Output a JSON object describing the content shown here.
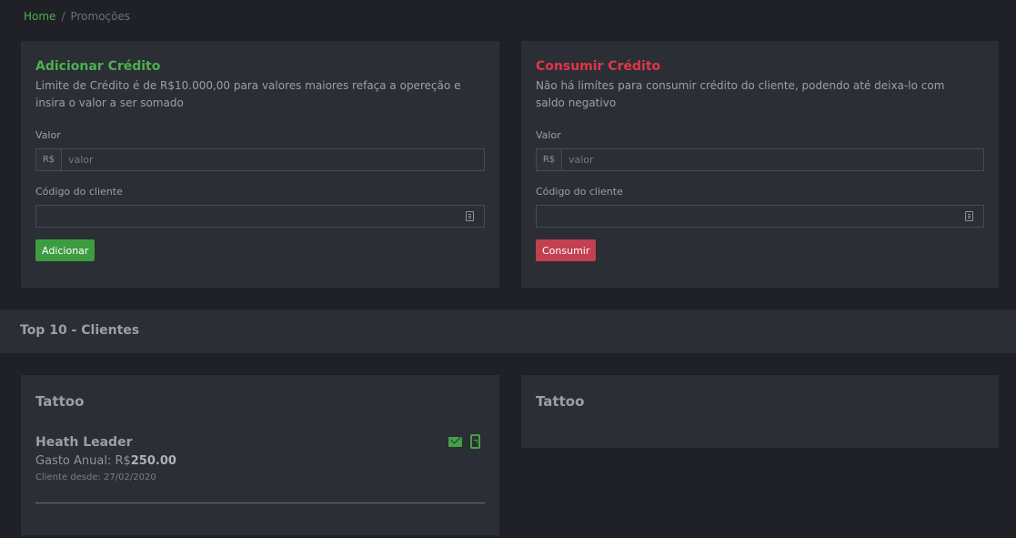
{
  "breadcrumb": {
    "home": "Home",
    "separator": "/",
    "current": "Promoções"
  },
  "add_credit": {
    "title": "Adicionar Crédito",
    "description": "Limite de Crédito é de R$10.000,00 para valores maiores refaça a opereção e insira o valor a ser somado",
    "value_label": "Valor",
    "currency_prefix": "R$",
    "value_placeholder": "valor",
    "client_code_label": "Código do cliente",
    "client_code_value": "",
    "button_label": "Adicionar",
    "title_color": "#4caf50",
    "button_color": "#3d9c40"
  },
  "consume_credit": {
    "title": "Consumir Crédito",
    "description": "Não há limítes para consumir crédito do cliente, podendo até deixa-lo com saldo negativo",
    "value_label": "Valor",
    "currency_prefix": "R$",
    "value_placeholder": "valor",
    "client_code_label": "Código do cliente",
    "client_code_value": "",
    "button_label": "Consumir",
    "title_color": "#e0364a",
    "button_color": "#c2404f"
  },
  "top_clients": {
    "section_title": "Top 10 - Clientes",
    "columns": [
      {
        "title": "Tattoo",
        "clients": [
          {
            "name": "Heath Leader",
            "spent_label": "Gasto Anual: R$",
            "spent_value": "250.00",
            "since": "Cliente desde: 27/02/2020",
            "icons": [
              "mail-icon",
              "phone-icon"
            ]
          }
        ]
      },
      {
        "title": "Tattoo",
        "clients": []
      }
    ]
  }
}
